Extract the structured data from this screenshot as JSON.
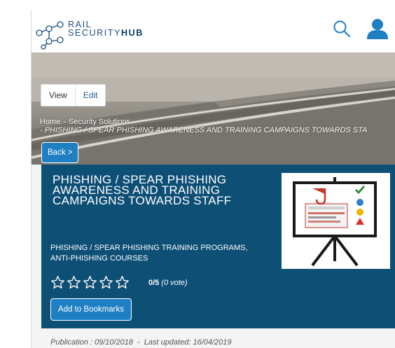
{
  "header": {
    "logo_line1": "RAIL",
    "logo_line2_prefix": "SECURITY",
    "logo_line2_bold": "HUB",
    "icons": [
      "search-icon",
      "user-icon"
    ],
    "brand_color": "#1d4f7c"
  },
  "tabs": [
    {
      "label": "View"
    },
    {
      "label": "Edit"
    }
  ],
  "breadcrumb": {
    "home": "Home",
    "separator": "-",
    "section": "Security Solutions",
    "current": "-  PHISHING / SPEAR PHISHING AWARENESS AND TRAINING CAMPAIGNS TOWARDS STA"
  },
  "back_label": "Back >",
  "article": {
    "title": "PHISHING / SPEAR PHISHING AWARENESS AND TRAINING CAMPAIGNS TOWARDS STAFF",
    "subtitle": "PHISHING / SPEAR PHISHING TRAINING PROGRAMS, ANTI-PHISHING COURSES",
    "rating_score": "0/5",
    "rating_votes": "(0 vote)",
    "stars_filled": 0,
    "stars_total": 5,
    "bookmark_label": "Add to Bookmarks",
    "panel_color": "#0e4f76",
    "button_color": "#1f7fc3"
  },
  "meta": {
    "publication": "Publication : 09/10/2018",
    "separator": "-",
    "updated": "Last updated: 16/04/2019"
  }
}
